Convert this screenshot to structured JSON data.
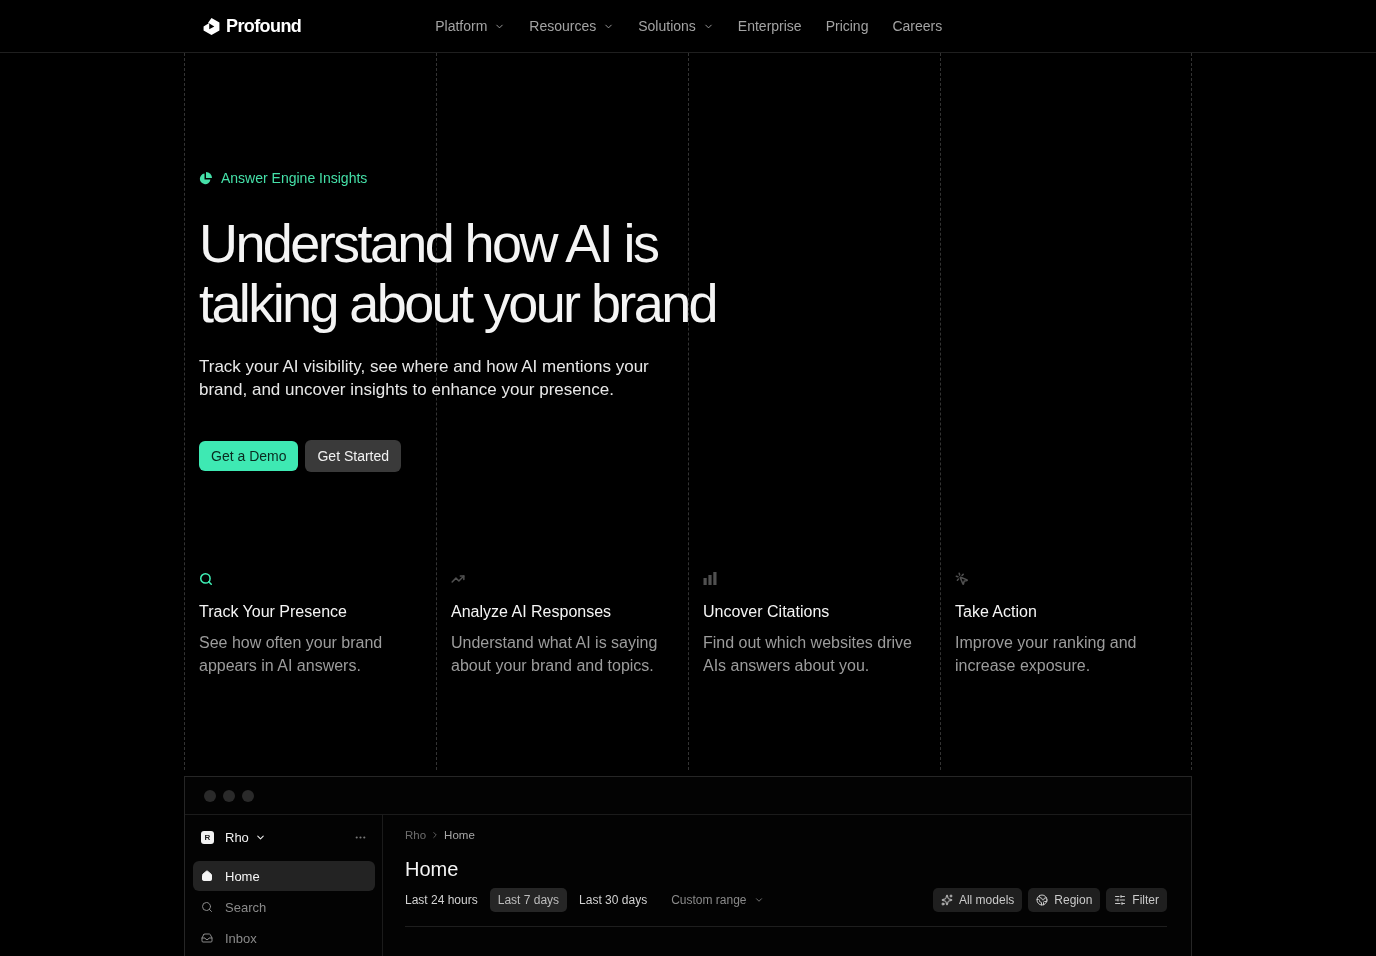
{
  "nav": {
    "logo": "Profound",
    "links": [
      {
        "label": "Platform",
        "has_menu": true
      },
      {
        "label": "Resources",
        "has_menu": true
      },
      {
        "label": "Solutions",
        "has_menu": true
      },
      {
        "label": "Enterprise",
        "has_menu": false
      },
      {
        "label": "Pricing",
        "has_menu": false
      },
      {
        "label": "Careers",
        "has_menu": false
      }
    ]
  },
  "hero": {
    "eyebrow": "Answer Engine Insights",
    "title": "Understand how AI is talking about your brand",
    "description": "Track your AI visibility, see where and how AI mentions your brand, and uncover insights to enhance your presence.",
    "buttons": [
      {
        "label": "Get a Demo",
        "kind": "primary"
      },
      {
        "label": "Get Started",
        "kind": "secondary"
      }
    ]
  },
  "features": [
    {
      "title": "Track Your Presence",
      "description": "See how often your brand appears in AI answers.",
      "highlighted": true
    },
    {
      "title": "Analyze AI Responses",
      "description": "Understand what AI is saying about your brand and topics.",
      "highlighted": false
    },
    {
      "title": "Uncover Citations",
      "description": "Find out which websites drive AIs answers about you.",
      "highlighted": false
    },
    {
      "title": "Take Action",
      "description": "Improve your ranking and increase exposure.",
      "highlighted": false
    }
  ],
  "app_window": {
    "sidebar": {
      "workspace_badge": "R",
      "workspace": "Rho",
      "items": [
        {
          "label": "Home",
          "selected": true
        },
        {
          "label": "Search",
          "selected": false
        },
        {
          "label": "Inbox",
          "selected": false
        }
      ]
    },
    "main": {
      "breadcrumb": [
        "Rho",
        "Home"
      ],
      "title": "Home",
      "ranges": [
        {
          "label": "Last 24 hours",
          "selected": false
        },
        {
          "label": "Last 7 days",
          "selected": true
        },
        {
          "label": "Last 30 days",
          "selected": false
        }
      ],
      "custom_range": "Custom range",
      "actions": [
        "All models",
        "Region",
        "Filter"
      ]
    }
  }
}
